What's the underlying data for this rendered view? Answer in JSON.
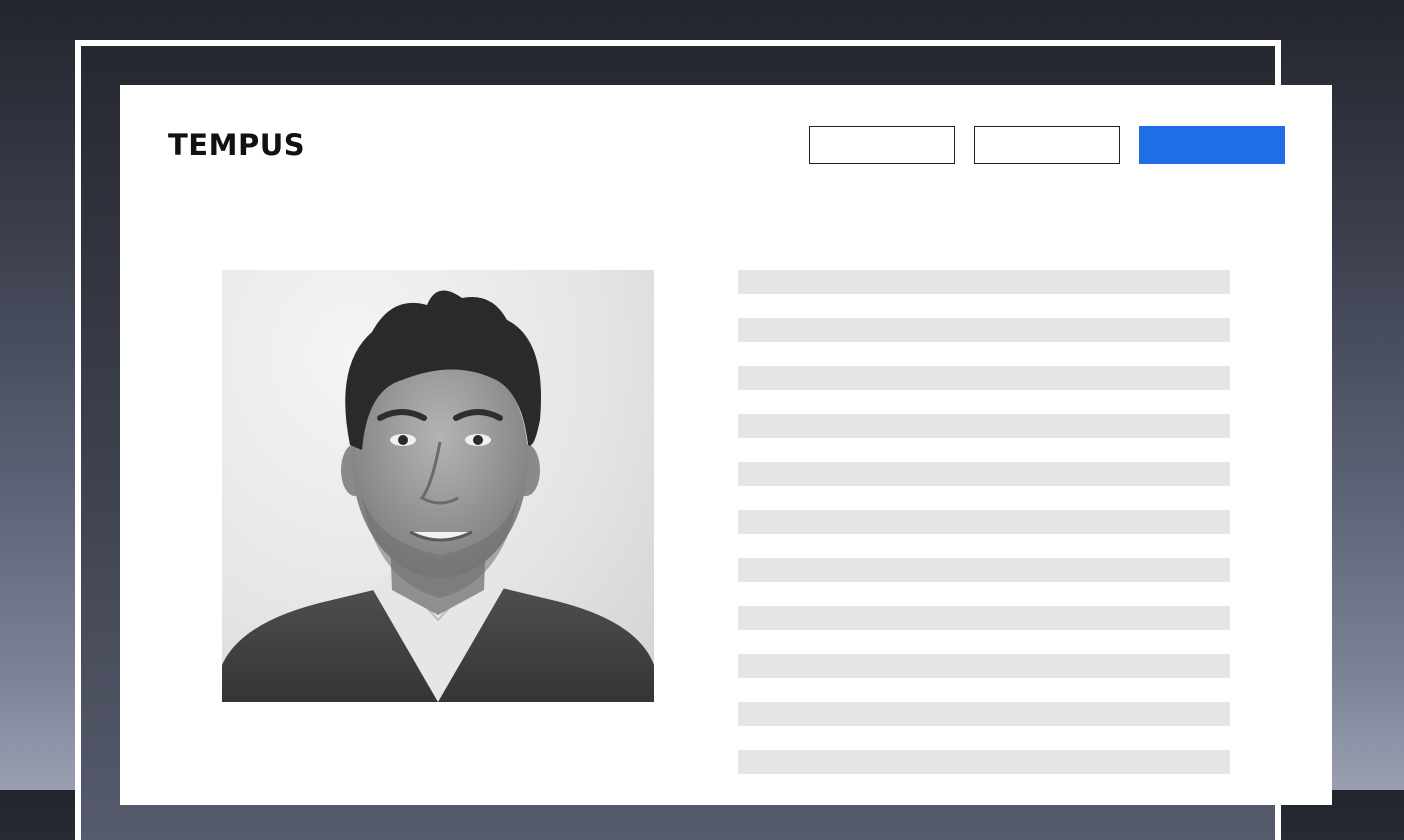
{
  "brand": {
    "logo_text": "TEMPUS",
    "cta_color": "#1f6de7"
  },
  "header": {
    "nav_buttons": [
      "",
      ""
    ],
    "cta_label": ""
  },
  "profile": {
    "photo": "person-portrait-photo",
    "text_placeholder_lines": 11
  }
}
